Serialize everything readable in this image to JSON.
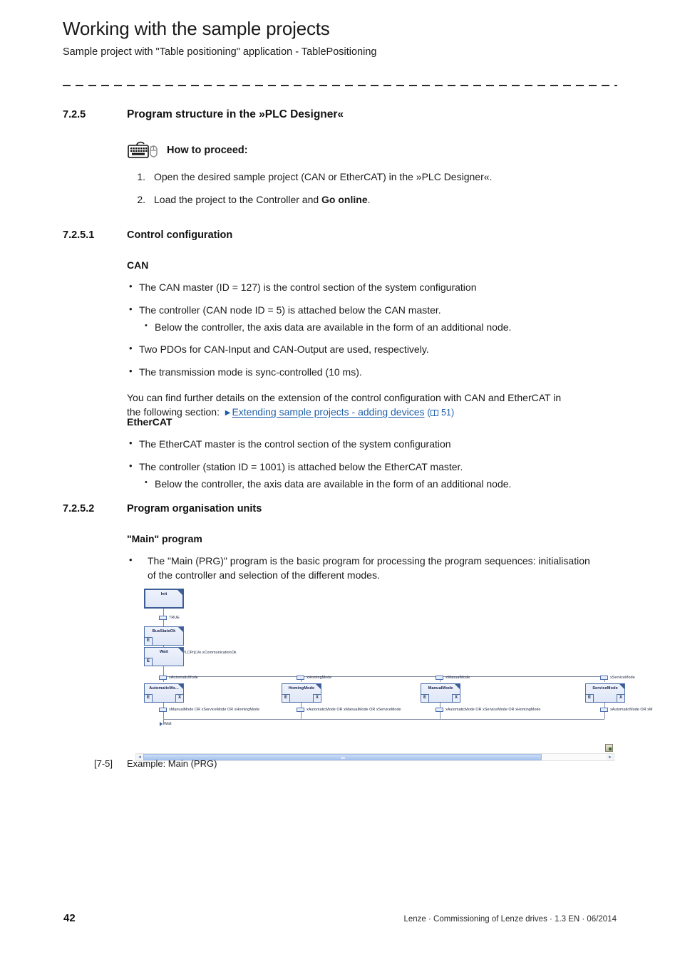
{
  "header": {
    "title": "Working with the sample projects",
    "subtitle": "Sample project with \"Table positioning\" application - TablePositioning"
  },
  "sections": {
    "s725": {
      "number": "7.2.5",
      "title": "Program structure in the »PLC Designer«"
    },
    "s7251": {
      "number": "7.2.5.1",
      "title": "Control configuration"
    },
    "s7252": {
      "number": "7.2.5.2",
      "title": "Program organisation units"
    }
  },
  "howto": {
    "icon": "keyboard-mouse-icon",
    "heading": "How to proceed:",
    "steps": [
      {
        "num": "1.",
        "text": "Open the desired sample project (CAN or EtherCAT) in the »PLC Designer«."
      },
      {
        "num": "2.",
        "text_before": "Load the project to the Controller and ",
        "text_bold": "Go online",
        "text_after": "."
      }
    ]
  },
  "can": {
    "heading": "CAN",
    "bullets": [
      {
        "level": 1,
        "text": "The CAN master (ID = 127) is the control section of the system configuration"
      },
      {
        "level": 1,
        "text": "The controller (CAN node ID = 5) is attached below the CAN master."
      },
      {
        "level": 2,
        "text": "Below the controller, the axis data are available in the form of an additional node."
      },
      {
        "level": 1,
        "text": "Two PDOs for CAN-Input and CAN-Output are used, respectively."
      },
      {
        "level": 1,
        "text": "The transmission mode is sync-controlled (10 ms)."
      }
    ],
    "paragraph_line1": "You can find further details on the extension of the control configuration with CAN and EtherCAT in",
    "paragraph_line2_before": "the following section:",
    "link_text": "Extending sample projects - adding devices",
    "link_page": "51",
    "link_color": "#1f5fa9"
  },
  "ethercat": {
    "heading": "EtherCAT",
    "bullets": [
      {
        "level": 1,
        "text": "The EtherCAT master is the control section of the system configuration"
      },
      {
        "level": 1,
        "text": "The controller (station ID = 1001) is attached below the EtherCAT master."
      },
      {
        "level": 2,
        "text": "Below the controller, the axis data are available in the form of an additional node."
      }
    ]
  },
  "main_program": {
    "heading": "\"Main\" program",
    "bullets": [
      {
        "level": 1,
        "text": "The \"Main (PRG)\" program is the basic program for processing the program sequences: initialisation of the controller and selection of the different modes."
      }
    ]
  },
  "figure": {
    "caption_number": "[7-5]",
    "caption_text": "Example: Main (PRG)",
    "sfc": {
      "steps": [
        {
          "id": "init",
          "label": "Init",
          "flags": []
        },
        {
          "id": "busstatsok",
          "label": "BusStatsOk",
          "flags": [
            "E"
          ]
        },
        {
          "id": "wait",
          "label": "Wait",
          "flags": [
            "E"
          ]
        },
        {
          "id": "automaticmode",
          "label": "AutomaticMo...",
          "flags": [
            "E",
            "X"
          ]
        },
        {
          "id": "homingmode",
          "label": "HomingMode",
          "flags": [
            "E",
            "X"
          ]
        },
        {
          "id": "manualmode",
          "label": "ManualMode",
          "flags": [
            "E",
            "X"
          ]
        },
        {
          "id": "servicemode",
          "label": "ServiceMode",
          "flags": [
            "E",
            "X"
          ]
        }
      ],
      "transitions": [
        {
          "id": "t1",
          "text": "TRUE"
        },
        {
          "id": "t2",
          "text": "L_SMI1PLCPrjLVe.xCommunicationOk"
        },
        {
          "id": "t3",
          "text": "xAutomaticMode"
        },
        {
          "id": "t4",
          "text": "xHomingMode"
        },
        {
          "id": "t5",
          "text": "xManualMode"
        },
        {
          "id": "t6",
          "text": "xServiceMode"
        },
        {
          "id": "t7",
          "text": "xManualMode OR xServiceMode OR xHomingMode"
        },
        {
          "id": "t8",
          "text": "xAutomaticMode OR xManualMode OR xServiceMode"
        },
        {
          "id": "t9",
          "text": "xAutomaticMode OR xServiceMode OR xHomingMode"
        },
        {
          "id": "t10",
          "text": "xAutomaticMode OR xM"
        }
      ],
      "jump": {
        "label": "Wait"
      }
    },
    "scrollbar": {
      "left_arrow": "◄",
      "right_arrow": "►",
      "thumb_percent": "86"
    }
  },
  "footer": {
    "page_number": "42",
    "text": "Lenze · Commissioning of Lenze drives · 1.3 EN · 06/2014"
  }
}
